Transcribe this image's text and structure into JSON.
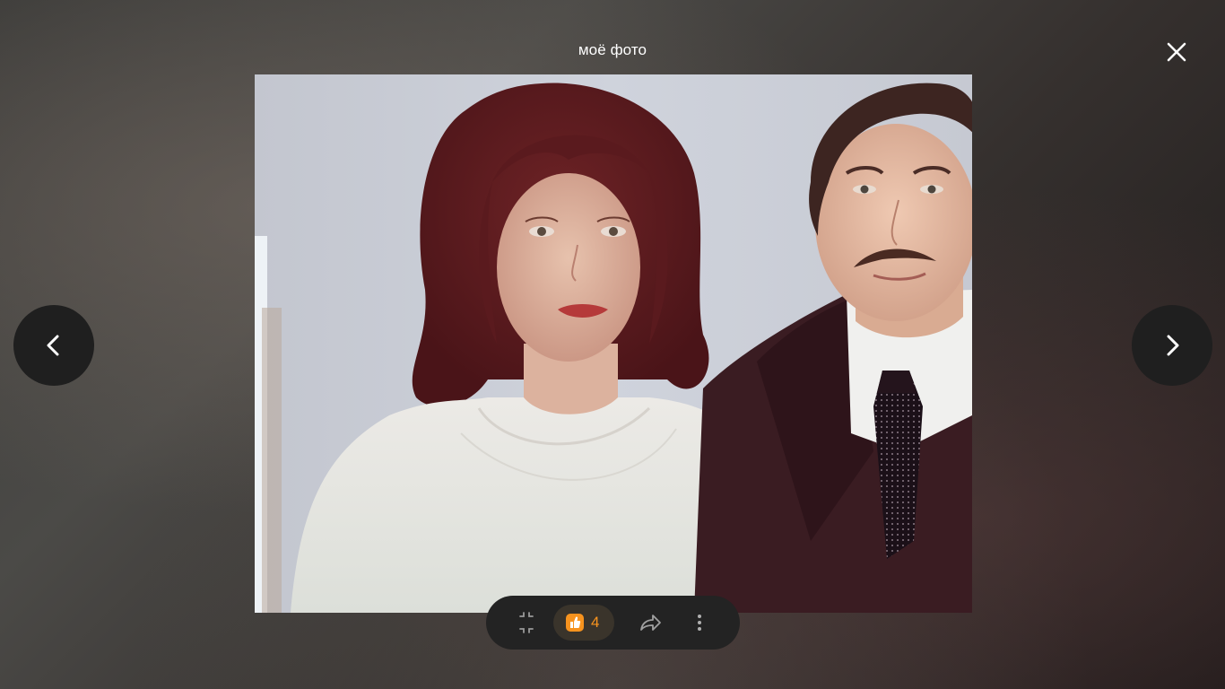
{
  "viewer": {
    "title": "моё фото"
  },
  "toolbar": {
    "like_count": "4"
  },
  "icons": {
    "close": "close-icon",
    "prev": "chevron-left-icon",
    "next": "chevron-right-icon",
    "collapse": "collapse-icon",
    "like": "thumbs-up-icon",
    "share": "share-icon",
    "more": "more-vertical-icon"
  },
  "colors": {
    "accent": "#f7931e",
    "toolbar_bg": "#232323",
    "nav_bg": "#1f1f1f"
  }
}
